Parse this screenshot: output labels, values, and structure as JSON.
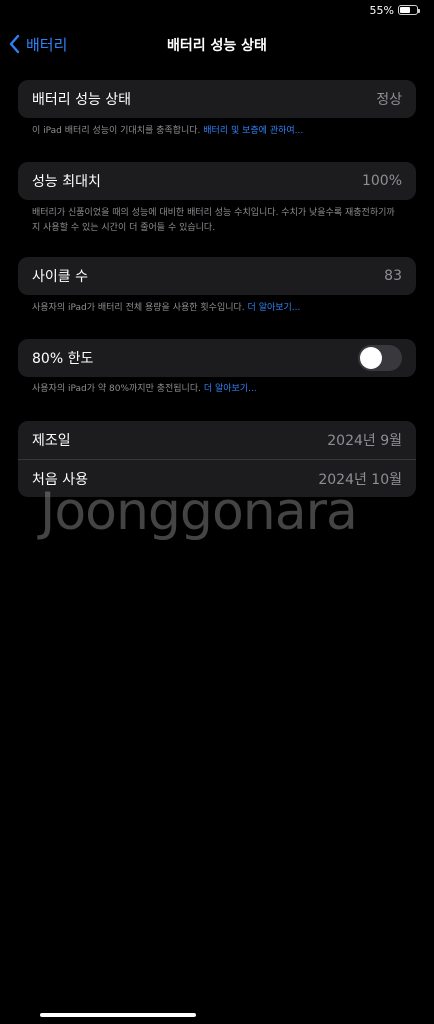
{
  "status_bar": {
    "battery_percent": "55%",
    "battery_level": 0.55
  },
  "nav": {
    "back_label": "배터리",
    "title": "배터리 성능 상태"
  },
  "sections": {
    "health": {
      "label": "배터리 성능 상태",
      "value": "정상",
      "footnote": "이 iPad 배터리 성능이 기대치를 충족합니다.",
      "footnote_link": "배터리 및 보증에 관하여..."
    },
    "max_capacity": {
      "label": "성능 최대치",
      "value": "100%",
      "footnote": "배터리가 신품이었을 때의 성능에 대비한 배터리 성능 수치입니다. 수치가 낮을수록 재충전하기까지 사용할 수 있는 시간이 더 줄어들 수 있습니다."
    },
    "cycle_count": {
      "label": "사이클 수",
      "value": "83",
      "footnote": "사용자의 iPad가 배터리 전체 용량을 사용한 횟수입니다.",
      "footnote_link": "더 알아보기..."
    },
    "limit_80": {
      "label": "80% 한도",
      "toggle_on": false,
      "footnote": "사용자의 iPad가 약 80%까지만 충전됩니다.",
      "footnote_link": "더 알아보기..."
    },
    "dates": {
      "manufacture_label": "제조일",
      "manufacture_value": "2024년 9월",
      "first_use_label": "처음 사용",
      "first_use_value": "2024년 10월"
    }
  },
  "watermark": "Joonggonara",
  "colors": {
    "accent": "#2f82f5",
    "group_bg": "#1c1c1e",
    "secondary_text": "#8e8e93"
  }
}
